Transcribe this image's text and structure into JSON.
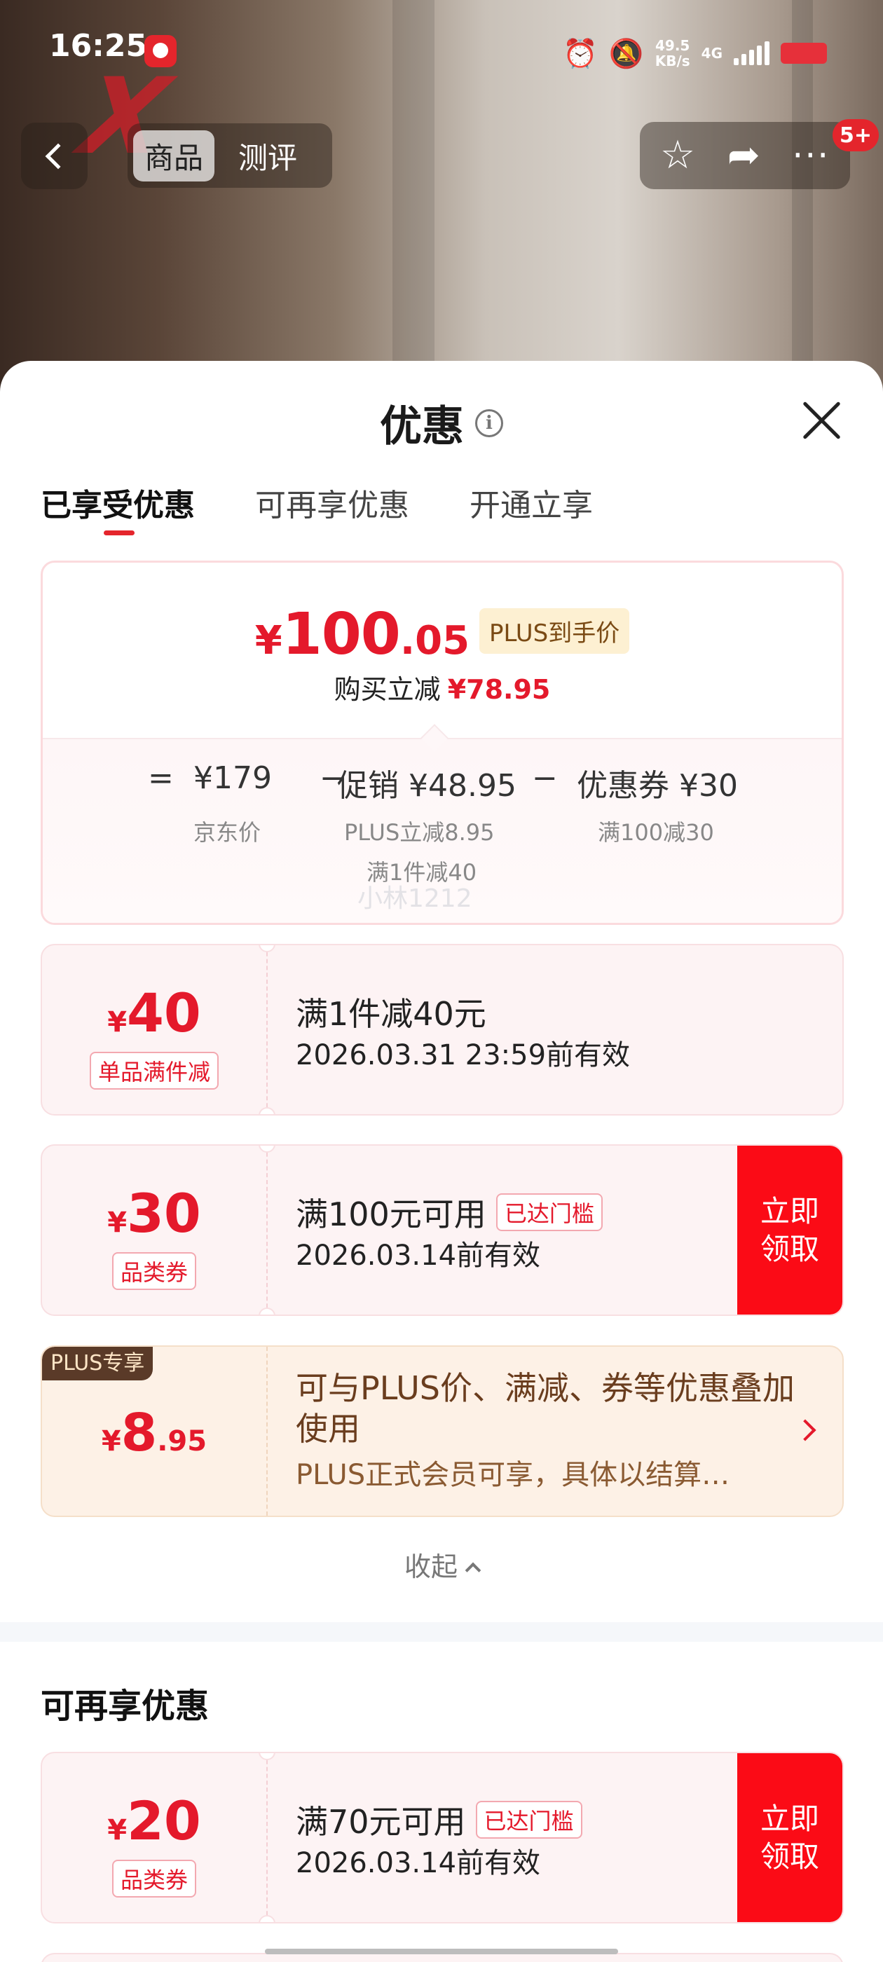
{
  "status_bar": {
    "time": "16:25",
    "speed_value": "49.5",
    "speed_unit": "KB/s",
    "network": "4G",
    "icons": [
      "alarm-icon",
      "mute-icon",
      "signal-icon",
      "battery-icon"
    ]
  },
  "nav": {
    "tabs": [
      {
        "label": "商品",
        "active": true
      },
      {
        "label": "测评",
        "active": false
      }
    ],
    "tools": [
      "star-icon",
      "share-icon",
      "more-icon"
    ],
    "badge": "5+"
  },
  "sheet": {
    "title": "优惠",
    "tabs": [
      {
        "label": "已享受优惠",
        "active": true
      },
      {
        "label": "可再享优惠",
        "active": false
      },
      {
        "label": "开通立享",
        "active": false
      }
    ],
    "summary": {
      "currency": "¥",
      "price_int": "100",
      "price_dec": ".05",
      "price_tag": "PLUS到手价",
      "instant_label": "购买立减",
      "instant_value": "¥78.95",
      "eq": "=",
      "base_price": "¥179",
      "base_label": "京东价",
      "minus": "−",
      "promo": "促销 ¥48.95",
      "promo_sub1": "PLUS立减8.95",
      "promo_sub2": "满1件减40",
      "coupon": "优惠券 ¥30",
      "coupon_sub": "满100减30"
    },
    "watermark": "小林1212",
    "coupons": [
      {
        "yen": "¥",
        "amount": "40",
        "type": "单品满件减",
        "title": "满1件减40元",
        "date": "2026.03.31 23:59前有效"
      },
      {
        "yen": "¥",
        "amount": "30",
        "type": "品类券",
        "title": "满100元可用",
        "threshold": "已达门槛",
        "date": "2026.03.14前有效",
        "button": "立即领取"
      }
    ],
    "plus_card": {
      "badge": "PLUS专享",
      "yen": "¥",
      "amount": "8",
      "decimal": ".95",
      "text": "可与PLUS价、满减、券等优惠叠加使用",
      "sub": "PLUS正式会员可享，具体以结算…"
    },
    "collapse": "收起",
    "section2_title": "可再享优惠",
    "coupon2": {
      "yen": "¥",
      "amount": "20",
      "type": "品类券",
      "title": "满70元可用",
      "threshold": "已达门槛",
      "date": "2026.03.14前有效",
      "button": "立即领取"
    }
  },
  "colors": {
    "accent": "#e4192b",
    "button_red": "#fb0b16",
    "plus_bg": "#fdf1e6"
  }
}
